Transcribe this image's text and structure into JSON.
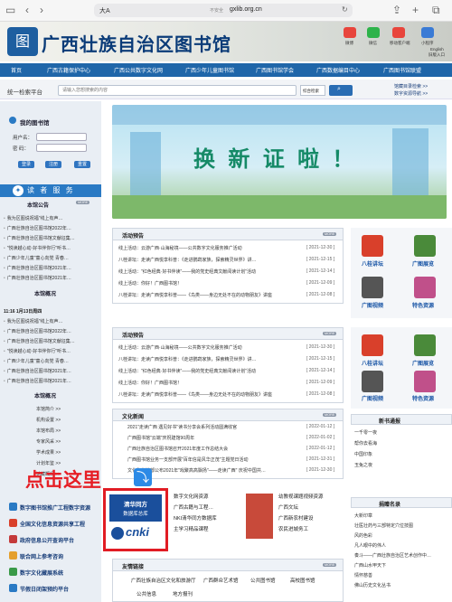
{
  "browser": {
    "tab_label": "大A",
    "url": "gxlib.org.cn",
    "secure_label": "不安全"
  },
  "header": {
    "logo_glyph": "图",
    "title": "广西壮族自治区图书馆",
    "top_icons": [
      {
        "label": "微博",
        "icon": "weibo-icon",
        "color": "#e8453c"
      },
      {
        "label": "微信",
        "icon": "wechat-icon",
        "color": "#2db34a"
      },
      {
        "label": "移动客户端",
        "icon": "mobile-app-icon",
        "color": "#e8453c"
      },
      {
        "label": "小程序",
        "icon": "mini-program-icon",
        "color": "#3a7bd5"
      }
    ],
    "lang": {
      "line1": "English",
      "line2": "旧版入口"
    }
  },
  "nav": [
    "首页",
    "广西古籍保护中心",
    "广西公共数字文化网",
    "广西少年儿童图书馆",
    "广西图书馆学会",
    "广西数据编目中心",
    "广西图书馆联盟"
  ],
  "search": {
    "label": "统一检索平台",
    "placeholder": "请输入您想搜索的内容",
    "select": "综合检索",
    "links": [
      "馆藏目录检索 >>",
      "数字资源导航 >>"
    ]
  },
  "sidebar": {
    "my_library": "我的图书馆",
    "user_label": "用户名：",
    "password_label": "密  码：",
    "buttons": [
      "登录",
      "注册",
      "重置"
    ],
    "reader_services": "读 者 服 务",
    "notice_title": "本馆公告",
    "more": "MORE",
    "notices": [
      "我为区图说祝福\"线上有声…",
      "广西壮族自治区图书馆2022年…",
      "广西壮族自治区图书馆文献征集…",
      "\"悦读越心动·好书伴你行\"听书…",
      "广西少年儿童\"童心向党 青春…",
      "广西壮族自治区图书馆2021年…",
      "广西壮族自治区图书馆2021年…"
    ],
    "overview_title": "本馆概况",
    "open_time": "11:16   1月13日周四",
    "notices2": [
      "我为区图说祝福\"线上有声…",
      "广西壮族自治区图书馆2022年…",
      "广西壮族自治区图书馆文献征集…",
      "\"悦读越心动·好书伴你行\"听书…",
      "广西少年儿童\"童心向党 青春…",
      "广西壮族自治区图书馆2021年…",
      "广西壮族自治区图书馆2021年…"
    ],
    "overview_title2": "本馆概况",
    "overview_links": [
      "本馆简介 >>",
      "机构设置 >>",
      "本馆布局 >>",
      "专家风采 >>",
      "学术成果 >>",
      "计划年鉴 >>",
      "馆藏概况 >>"
    ],
    "bottom_links": [
      {
        "label": "数字图书馆推广工程数字资源",
        "color": "#2a7ac4"
      },
      {
        "label": "全国文化信息资源共享工程",
        "color": "#d9402b"
      },
      {
        "label": "政府信息公开查询平台",
        "color": "#c43a3a"
      },
      {
        "label": "联合网上参考咨询",
        "color": "#e5a02d"
      },
      {
        "label": "数字文化藏展系统",
        "color": "#3a9a48"
      },
      {
        "label": "节假日闭架预约平台",
        "color": "#2a7ac4"
      }
    ]
  },
  "hero": {
    "text": "换 新 证 啦 ！"
  },
  "activities": {
    "title": "活动预告",
    "more": "MORE",
    "rows": [
      {
        "text": "线上活动：云游广西·山海秘境——公共数字文化服务推广活动",
        "date": "[ 2021-12-30 ]"
      },
      {
        "text": "八桂讲坛：走读广西悦享科普：《走进鹦鹉家族，探索精灵世界》讲…",
        "date": "[ 2021-12-15 ]"
      },
      {
        "text": "线上活动：\"红色经典·好书伴读\"——我的党史经典文献阅读计划\"活动",
        "date": "[ 2021-12-14 ]"
      },
      {
        "text": "线上活动：你好！广西图书馆！",
        "date": "[ 2021-12-09 ]"
      },
      {
        "text": "八桂讲坛：走读广西悦享科普——《鸟类——身边无处不在的动物朋友》讲座",
        "date": "[ 2021-12-08 ]"
      }
    ]
  },
  "activities2": {
    "title": "活动预告",
    "more": "MORE",
    "rows": [
      {
        "text": "线上活动：云游广西·山海秘境——公共数字文化服务推广活动",
        "date": "[ 2021-12-30 ]"
      },
      {
        "text": "八桂讲坛：走读广西悦享科普：《走进鹦鹉家族，探索精灵世界》讲…",
        "date": "[ 2021-12-15 ]"
      },
      {
        "text": "线上活动：\"红色经典·好书伴读\"——我的党史经典文献阅读计划\"活动",
        "date": "[ 2021-12-14 ]"
      },
      {
        "text": "线上活动：你好！广西图书馆！",
        "date": "[ 2021-12-09 ]"
      },
      {
        "text": "八桂讲坛：走读广西悦享科普——《鸟类——身边无处不在的动物朋友》讲座",
        "date": "[ 2021-12-08 ]"
      }
    ]
  },
  "culture_news": {
    "title": "文化新闻",
    "more": "MORE",
    "rows": [
      {
        "text": "2021\"走读广西 遇见好书\"读书分享会系列活动圆满收官",
        "date": "[ 2022-01-12 ]"
      },
      {
        "text": "广西图书馆\"云端\"庆祝建馆90周年",
        "date": "[ 2022-01-02 ]"
      },
      {
        "text": "广西壮族自治区图书馆召开2021年度工作总结大会",
        "date": "[ 2022-01-12 ]"
      },
      {
        "text": "广西图书馆业务一支部开展\"百年信是风华正茂\"主题党日活动",
        "date": "[ 2021-12-31 ]"
      },
      {
        "text": "文化和旅游部公布2021年\"戏聚高高飘扬\"——走读广西\" 庆祝中国共…",
        "date": "[ 2021-12-30 ]"
      }
    ]
  },
  "resources": {
    "cnki_top": "清华同方",
    "cnki_sub": "数据库总库",
    "cnki_logo": "cnki",
    "list_left": [
      "数字文化网资源",
      "广西古籍与工程…",
      "NKI清华同方数据库",
      "主学习精品课程"
    ],
    "list_right": [
      "幼教视课题视频资源",
      "广西文坛",
      "广西新农村建设",
      "农民进城务工"
    ]
  },
  "friend_links": {
    "title": "友情链接",
    "more": "MORE",
    "row1": [
      "广西壮族自治区文化和旅游厅",
      "广西群众艺术馆",
      "公共图书馆",
      "高校图书馆"
    ],
    "row2": [
      "公共信息",
      "地方报刊"
    ]
  },
  "right_col": {
    "tiles": [
      {
        "label": "八桂讲坛",
        "icon": "bagui-forum-icon",
        "color": "#d9402b"
      },
      {
        "label": "广图展览",
        "icon": "exhibition-icon",
        "color": "#4a8a3a"
      },
      {
        "label": "广图视频",
        "icon": "video-icon",
        "color": "#555555"
      },
      {
        "label": "特色资源",
        "icon": "special-resource-icon",
        "color": "#c0508a"
      }
    ],
    "news_title": "新书通报",
    "news_rows": [
      "一千零一夜",
      "帮你去看海",
      "中国印象",
      "玉兔之夜"
    ],
    "rank_title": "捐赠名录",
    "rank_rows": [
      "大新印章",
      "壮医壮药与三部特定穴位技图",
      "风的色彩",
      "凡人眼中的伟人",
      "奏斗——广西壮族自治区艺术创作中…",
      "广西山水甲天下",
      "情怀慈善",
      "佛山历史文化丛书"
    ]
  },
  "overlay": {
    "click_here": "点击这里",
    "arrow": "⤵"
  },
  "status": {
    "time": "11:16",
    "battery": "83%"
  }
}
